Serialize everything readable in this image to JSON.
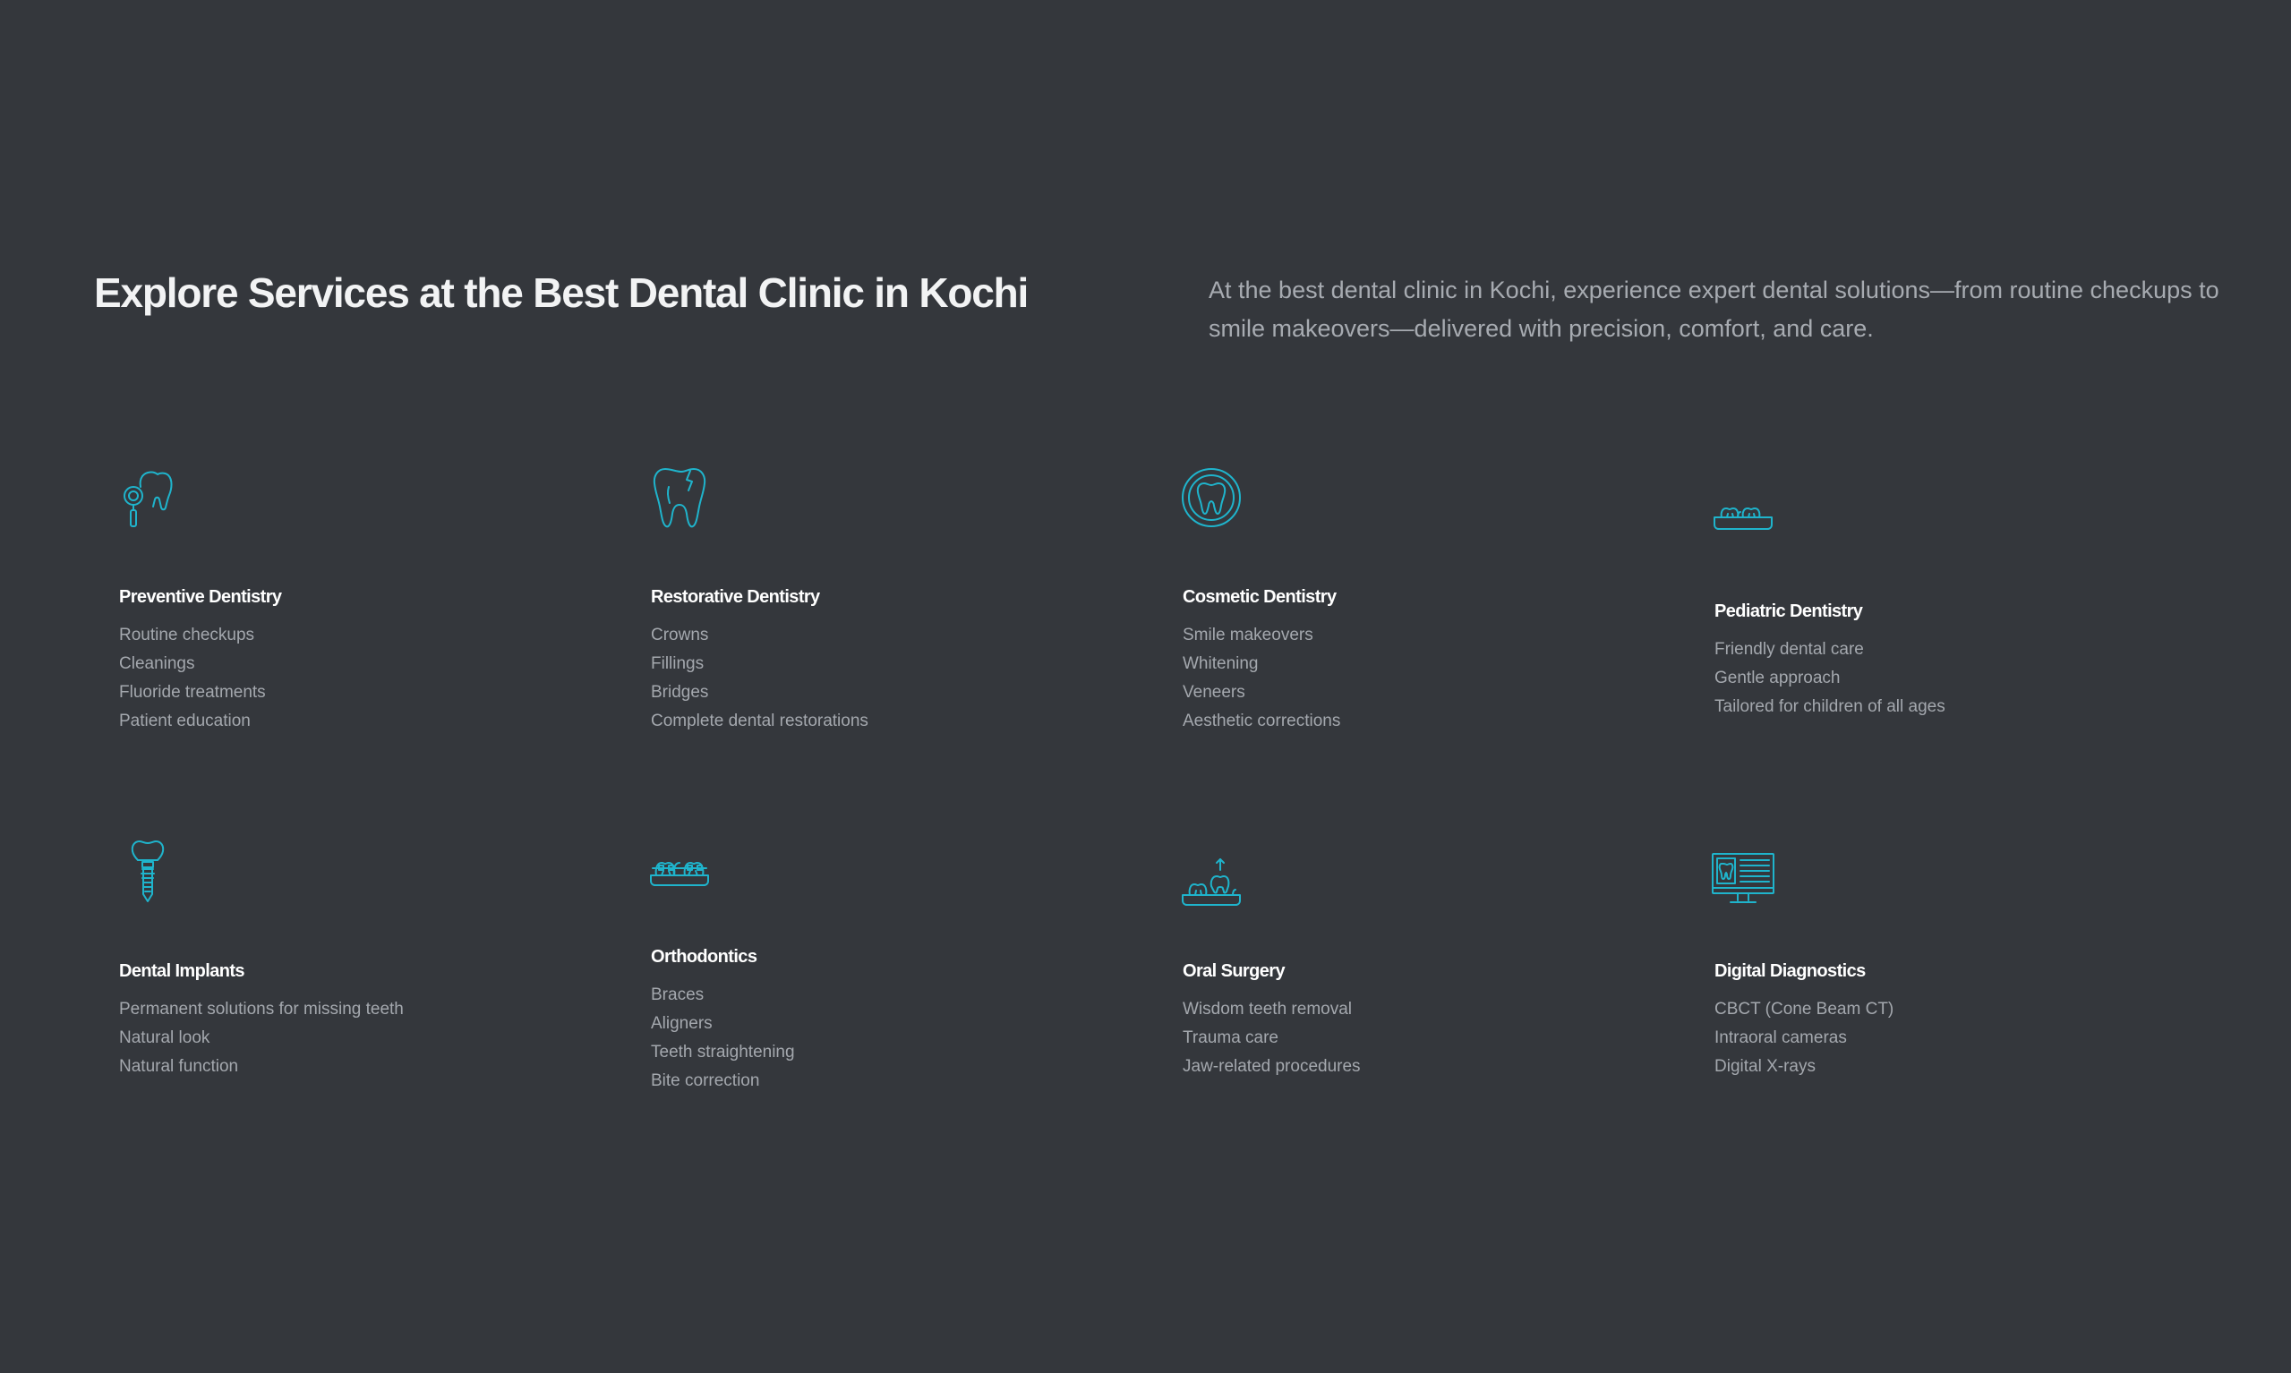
{
  "section": {
    "heading": "Explore Services at the Best Dental Clinic in Kochi",
    "intro": "At the best dental clinic in Kochi, experience expert dental solutions—from routine checkups to smile makeovers—delivered with precision, comfort, and care."
  },
  "accent_color": "#1fb4cc",
  "services": [
    {
      "icon": "tooth-magnifier-icon",
      "title": "Preventive Dentistry",
      "items": [
        "Routine checkups",
        "Cleanings",
        "Fluoride treatments",
        "Patient education"
      ]
    },
    {
      "icon": "broken-tooth-icon",
      "title": "Restorative Dentistry",
      "items": [
        "Crowns",
        "Fillings",
        "Bridges",
        "Complete dental restorations"
      ]
    },
    {
      "icon": "tooth-circle-icon",
      "title": "Cosmetic Dentistry",
      "items": [
        "Smile makeovers",
        "Whitening",
        "Veneers",
        "Aesthetic corrections"
      ]
    },
    {
      "icon": "teeth-row-icon",
      "title": "Pediatric Dentistry",
      "items": [
        "Friendly dental care",
        "Gentle approach",
        "Tailored for children of all ages"
      ]
    },
    {
      "icon": "dental-implant-icon",
      "title": "Dental Implants",
      "items": [
        "Permanent solutions for missing teeth",
        "Natural look",
        "Natural function"
      ]
    },
    {
      "icon": "braces-icon",
      "title": "Orthodontics",
      "items": [
        "Braces",
        "Aligners",
        "Teeth straightening",
        "Bite correction"
      ]
    },
    {
      "icon": "tooth-extraction-icon",
      "title": "Oral Surgery",
      "items": [
        "Wisdom teeth removal",
        "Trauma care",
        "Jaw-related procedures"
      ]
    },
    {
      "icon": "monitor-xray-icon",
      "title": "Digital Diagnostics",
      "items": [
        "CBCT (Cone Beam CT)",
        "Intraoral cameras",
        "Digital X-rays"
      ]
    }
  ]
}
